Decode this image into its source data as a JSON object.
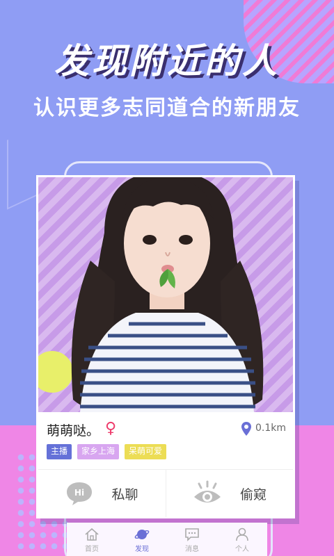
{
  "promo": {
    "headline": "发现附近的人",
    "subline": "认识更多志同道合的新朋友"
  },
  "profile": {
    "name": "萌萌哒。",
    "gender_symbol": "♀",
    "distance": "0.1km",
    "tags": [
      "主播",
      "家乡上海",
      "呆萌可爱"
    ]
  },
  "actions": {
    "chat_label": "私聊",
    "peek_label": "偷窥"
  },
  "tabbar": {
    "items": [
      {
        "label": "首页",
        "icon": "home-icon",
        "active": false
      },
      {
        "label": "发现",
        "icon": "planet-icon",
        "active": true
      },
      {
        "label": "消息",
        "icon": "message-icon",
        "active": false
      },
      {
        "label": "个人",
        "icon": "person-icon",
        "active": false
      }
    ]
  },
  "colors": {
    "background": "#8f9df4",
    "pink": "#ef86e6",
    "accent": "#6a6fd6",
    "gender": "#ee3b6b"
  }
}
